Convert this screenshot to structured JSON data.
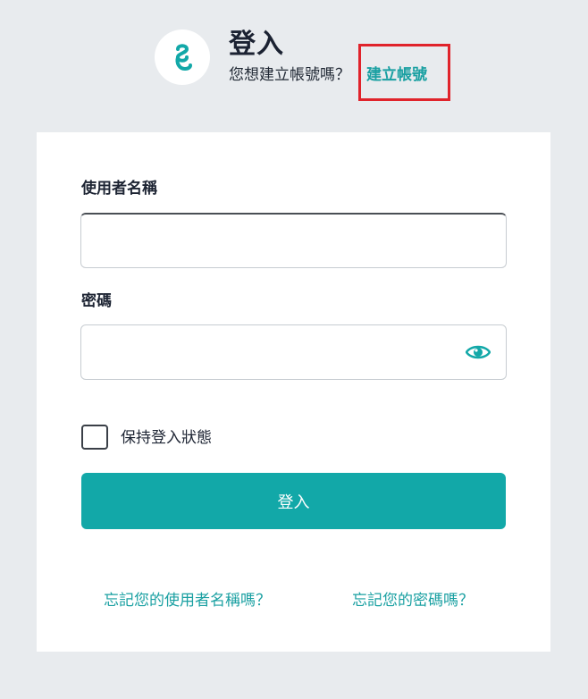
{
  "header": {
    "logo_icon": "brand-swirl-icon",
    "title": "登入",
    "subtitle": "您想建立帳號嗎？",
    "create_account_link": "建立帳號"
  },
  "form": {
    "username_label": "使用者名稱",
    "username_value": "",
    "password_label": "密碼",
    "password_value": "",
    "show_password_icon": "eye-icon",
    "remember_me_label": "保持登入狀態",
    "remember_me_checked": false,
    "submit_label": "登入"
  },
  "footer": {
    "forgot_username": "忘記您的使用者名稱嗎？",
    "forgot_password": "忘記您的密碼嗎？"
  },
  "colors": {
    "accent": "#12a8a8",
    "link": "#1aa0a2",
    "highlight_box": "#e0232b",
    "background": "#e8ebee"
  }
}
